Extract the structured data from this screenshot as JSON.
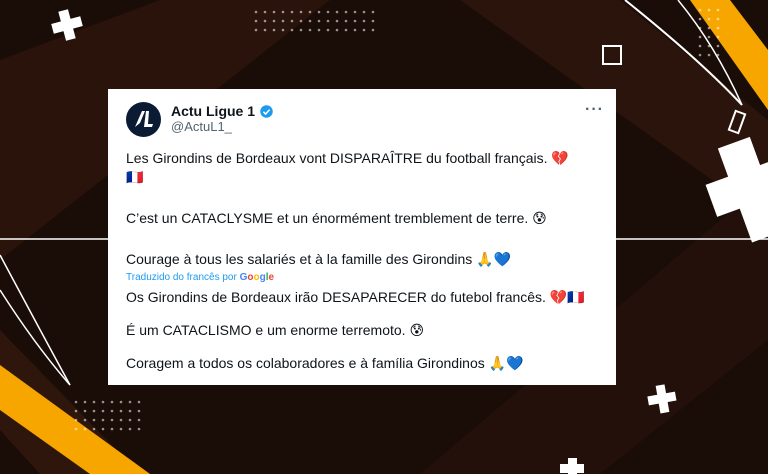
{
  "tweet": {
    "name": "Actu Ligue 1",
    "handle": "@ActuL1_",
    "avatar_text": "AL",
    "more_label": "···",
    "original": {
      "line1": "Les Girondins de Bordeaux vont DISPARAÎTRE du football français. 💔",
      "line1b": "🇫🇷",
      "line2": "C’est un CATACLYSME et un énormément tremblement de terre. 😰",
      "line3": "Courage à tous les salariés et à la famille des Girondins 🙏💙"
    },
    "translation_label": "Traduzido do francês por",
    "translation_provider": "Google",
    "translated": {
      "line1": "Os Girondins de Bordeaux irão DESAPARECER do futebol francês. 💔🇫🇷",
      "line2": "É um CATACLISMO e um enorme terremoto. 😰",
      "line3": "Coragem a todos os colaboradores e à família Girondinos 🙏💙"
    }
  },
  "colors": {
    "background": "#1a0c06",
    "accent": "#f7a600",
    "verified": "#1d9bf0",
    "link": "#1d9bf0"
  }
}
